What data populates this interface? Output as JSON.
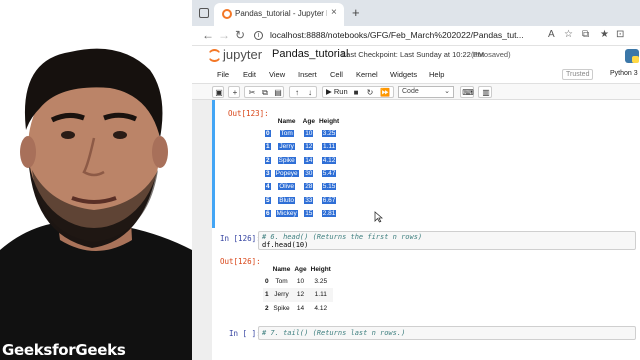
{
  "presenter_overlay": {
    "text": "GeeksforGeeks"
  },
  "browser": {
    "tab_title": "Pandas_tutorial - Jupyter Notebook",
    "tab_close": "×",
    "new_tab": "+",
    "url": "localhost:8888/notebooks/GFG/Feb_March%202022/Pandas_tut..."
  },
  "jupyter": {
    "logo_text": "jupyter",
    "notebook_name": "Pandas_tutorial",
    "checkpoint": "Last Checkpoint: Last Sunday at 10:22 PM",
    "autosave": "(autosaved)",
    "menus": [
      "File",
      "Edit",
      "View",
      "Insert",
      "Cell",
      "Kernel",
      "Widgets",
      "Help"
    ],
    "trusted": "Trusted",
    "kernel": "Python 3",
    "toolbar": {
      "run_label": "Run",
      "cell_type": "Code"
    }
  },
  "cells": {
    "out123": {
      "prompt": "Out[123]:",
      "columns": [
        "",
        "Name",
        "Age",
        "Height"
      ],
      "rows": [
        [
          "0",
          "Tom",
          "10",
          "3.25"
        ],
        [
          "1",
          "Jerry",
          "12",
          "1.11"
        ],
        [
          "2",
          "Spike",
          "14",
          "4.12"
        ],
        [
          "3",
          "Popeye",
          "30",
          "5.47"
        ],
        [
          "4",
          "Olive",
          "28",
          "5.15"
        ],
        [
          "5",
          "Bluto",
          "33",
          "6.67"
        ],
        [
          "6",
          "Mickey",
          "15",
          "2.81"
        ]
      ]
    },
    "in126": {
      "prompt": "In [126]:",
      "line1": "# 6. head() (Returns the first n rows)",
      "line2": "df.head(10)"
    },
    "out126": {
      "prompt": "Out[126]:",
      "columns": [
        "",
        "Name",
        "Age",
        "Height"
      ],
      "rows": [
        [
          "0",
          "Tom",
          "10",
          "3.25"
        ],
        [
          "1",
          "Jerry",
          "12",
          "1.11"
        ],
        [
          "2",
          "Spike",
          "14",
          "4.12"
        ]
      ]
    },
    "in_empty": {
      "prompt": "In [ ]:",
      "line1": "# 7. tail() (Returns last n rows.)"
    }
  }
}
